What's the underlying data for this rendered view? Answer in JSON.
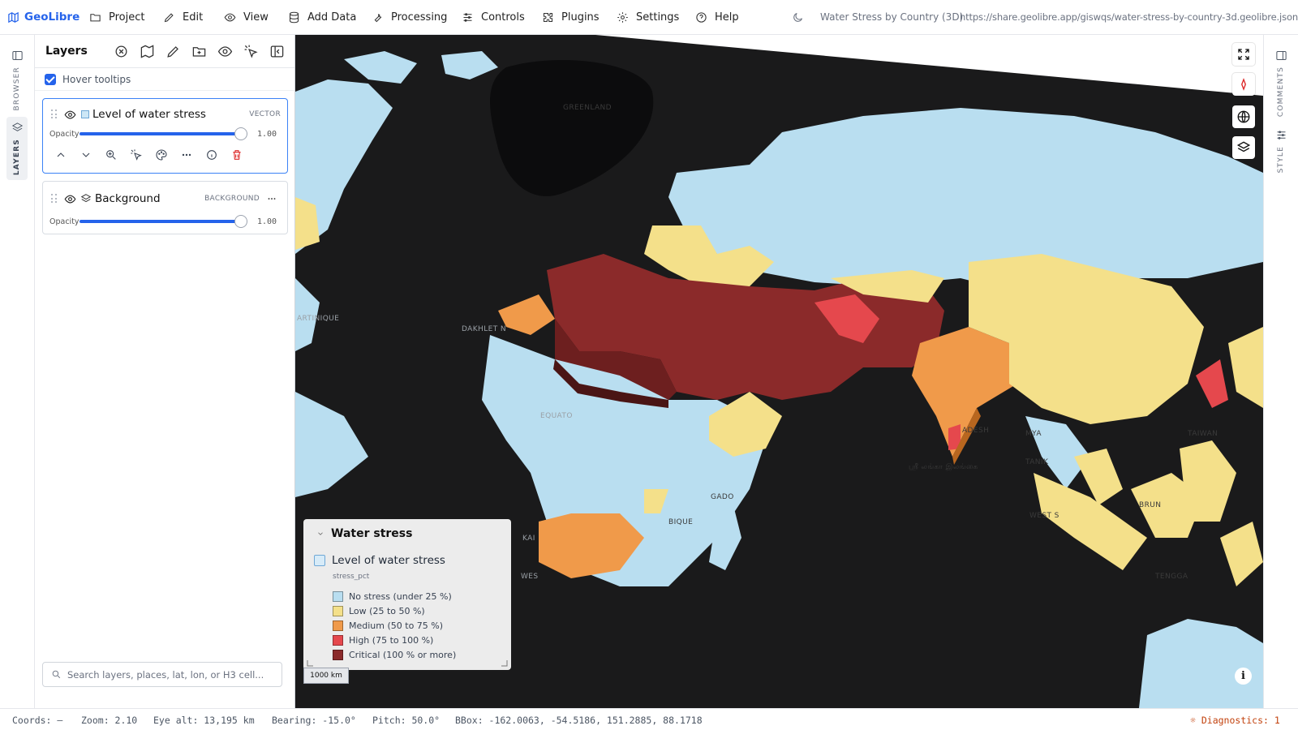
{
  "app": {
    "name": "GeoLibre"
  },
  "menu": [
    {
      "label": "Project",
      "icon": "folder-icon"
    },
    {
      "label": "Edit",
      "icon": "pencil-icon"
    },
    {
      "label": "View",
      "icon": "eye-icon"
    },
    {
      "label": "Add Data",
      "icon": "database-icon"
    },
    {
      "label": "Processing",
      "icon": "wrench-icon"
    },
    {
      "label": "Controls",
      "icon": "sliders-icon"
    },
    {
      "label": "Plugins",
      "icon": "puzzle-icon"
    },
    {
      "label": "Settings",
      "icon": "gear-icon"
    },
    {
      "label": "Help",
      "icon": "help-icon"
    }
  ],
  "document": {
    "title": "Water Stress by Country (3D)",
    "url": "https://share.geolibre.app/giswqs/water-stress-by-country-3d.geolibre.json"
  },
  "left_rail": {
    "browser": "BROWSER",
    "layers": "LAYERS"
  },
  "right_rail": {
    "comments": "COMMENTS",
    "style": "STYLE"
  },
  "layers_panel": {
    "title": "Layers",
    "hover_tooltips_label": "Hover tooltips",
    "hover_tooltips_checked": true,
    "layers": [
      {
        "name": "Level of water stress",
        "type": "VECTOR",
        "opacity_label": "Opacity",
        "opacity": "1.00",
        "visible": true,
        "selected": true
      },
      {
        "name": "Background",
        "type": "BACKGROUND",
        "opacity_label": "Opacity",
        "opacity": "1.00",
        "visible": true,
        "selected": false
      }
    ],
    "search_placeholder": "Search layers, places, lat, lon, or H3 cell..."
  },
  "legend": {
    "title": "Water stress",
    "layer_name": "Level of water stress",
    "field": "stress_pct",
    "items": [
      {
        "label": "No stress (under 25 %)",
        "color": "#b9def0"
      },
      {
        "label": "Low (25 to 50 %)",
        "color": "#f4e08a"
      },
      {
        "label": "Medium (50 to 75 %)",
        "color": "#f09a4a"
      },
      {
        "label": "High (75 to 100 %)",
        "color": "#e5484d"
      },
      {
        "label": "Critical (100 % or more)",
        "color": "#8b2a2a"
      }
    ]
  },
  "map": {
    "scale_label": "1000 km",
    "labels": [
      "GREENLAND",
      "DAKHLET N",
      "EQUATO",
      "ADESH",
      "TAIWAN",
      "MYA",
      "TANIK",
      "WEST S",
      "BRUN",
      "GADO",
      "BIQUE",
      "WES",
      "KAI",
      "TENGGA",
      "ARTINIQUE",
      "ஸ்ரீ லங்கா இலங்கை"
    ]
  },
  "status": {
    "coords": "Coords: —",
    "zoom": "Zoom: 2.10",
    "eye_alt": "Eye alt: 13,195 km",
    "bearing": "Bearing: -15.0°",
    "pitch": "Pitch: 50.0°",
    "bbox": "BBox: -162.0063, -54.5186, 151.2885, 88.1718",
    "diagnostics": "Diagnostics: 1"
  }
}
